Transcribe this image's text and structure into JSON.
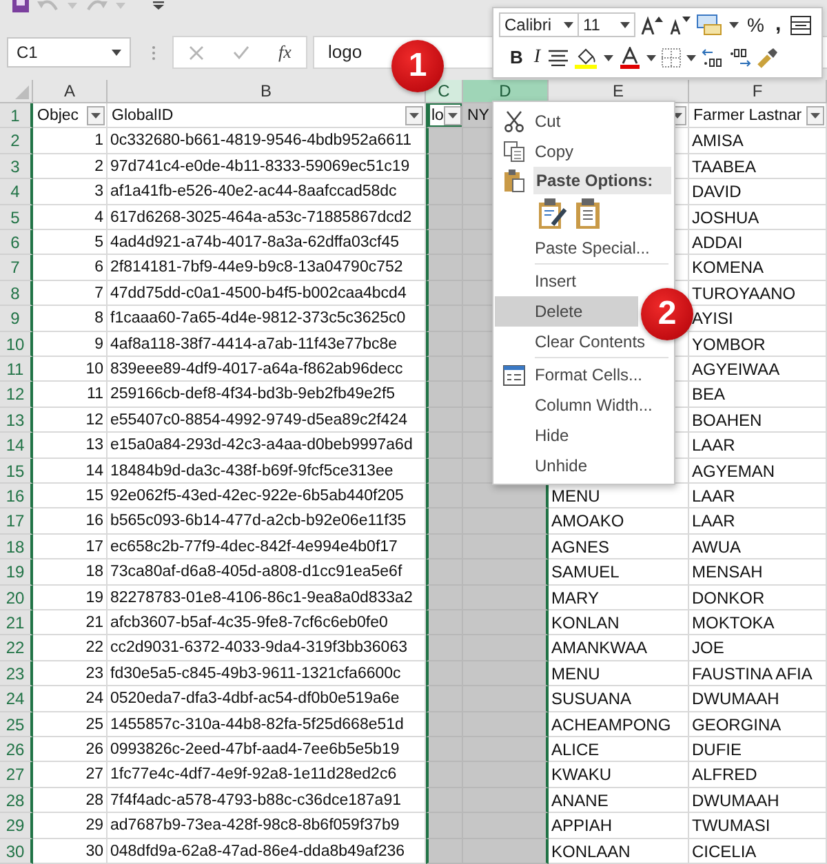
{
  "formula_bar": {
    "name_box": "C1",
    "function_label": "fx",
    "formula": "logo"
  },
  "mini_toolbar": {
    "font": "Calibri",
    "size": "11",
    "percent": "%",
    "comma": ",",
    "bold": "B",
    "italic": "I"
  },
  "sheet": {
    "columns": [
      {
        "letter": "A",
        "selected": false,
        "hot": false
      },
      {
        "letter": "B",
        "selected": false,
        "hot": false
      },
      {
        "letter": "C",
        "selected": true,
        "hot": false
      },
      {
        "letter": "D",
        "selected": true,
        "hot": true
      },
      {
        "letter": "E",
        "selected": false,
        "hot": false
      },
      {
        "letter": "F",
        "selected": false,
        "hot": false
      }
    ],
    "header_row": {
      "number": "1",
      "cells": [
        {
          "text": "Objec",
          "filter": true,
          "active": false
        },
        {
          "text": "GlobalID",
          "filter": true,
          "active": false
        },
        {
          "text": "lo",
          "filter": true,
          "active": true
        },
        {
          "text": "NY",
          "filter": false,
          "active": false
        },
        {
          "filter": true,
          "active": false
        },
        {
          "text": "Farmer Lastnar",
          "filter": true,
          "active": false
        }
      ]
    },
    "rows": [
      {
        "number": "2",
        "cells": [
          "1",
          "0c332680-b661-4819-9546-4bdb952a6611",
          null,
          null,
          null,
          "AMISA"
        ]
      },
      {
        "number": "3",
        "cells": [
          "2",
          "97d741c4-e0de-4b11-8333-59069ec51c19",
          null,
          null,
          null,
          "TAABEA"
        ]
      },
      {
        "number": "4",
        "cells": [
          "3",
          "af1a41fb-e526-40e2-ac44-8aafccad58dc",
          null,
          null,
          null,
          "DAVID"
        ]
      },
      {
        "number": "5",
        "cells": [
          "4",
          "617d6268-3025-464a-a53c-71885867dcd2",
          null,
          null,
          null,
          "JOSHUA"
        ]
      },
      {
        "number": "6",
        "cells": [
          "5",
          "4ad4d921-a74b-4017-8a3a-62dffa03cf45",
          null,
          null,
          null,
          "ADDAI"
        ]
      },
      {
        "number": "7",
        "cells": [
          "6",
          "2f814181-7bf9-44e9-b9c8-13a04790c752",
          null,
          null,
          null,
          "KOMENA"
        ]
      },
      {
        "number": "8",
        "cells": [
          "7",
          "47dd75dd-c0a1-4500-b4f5-b002caa4bcd4",
          null,
          null,
          null,
          "TUROYAANO"
        ]
      },
      {
        "number": "9",
        "cells": [
          "8",
          "f1caaa60-7a65-4d4e-9812-373c5c3625c0",
          null,
          null,
          null,
          "AYISI"
        ]
      },
      {
        "number": "10",
        "cells": [
          "9",
          "4af8a118-38f7-4414-a7ab-11f43e77bc8e",
          null,
          null,
          null,
          "YOMBOR"
        ]
      },
      {
        "number": "11",
        "cells": [
          "10",
          "839eee89-4df9-4017-a64a-f862ab96decc",
          null,
          null,
          null,
          "AGYEIWAA"
        ]
      },
      {
        "number": "12",
        "cells": [
          "11",
          "259166cb-def8-4f34-bd3b-9eb2fb49e2f5",
          null,
          null,
          null,
          "BEA"
        ]
      },
      {
        "number": "13",
        "cells": [
          "12",
          "e55407c0-8854-4992-9749-d5ea89c2f424",
          null,
          null,
          null,
          "BOAHEN"
        ]
      },
      {
        "number": "14",
        "cells": [
          "13",
          "e15a0a84-293d-42c3-a4aa-d0beb9997a6d",
          null,
          null,
          null,
          "LAAR"
        ]
      },
      {
        "number": "15",
        "cells": [
          "14",
          "18484b9d-da3c-438f-b69f-9fcf5ce313ee",
          null,
          null,
          null,
          "AGYEMAN"
        ]
      },
      {
        "number": "16",
        "cells": [
          "15",
          "92e062f5-43ed-42ec-922e-6b5ab440f205",
          null,
          null,
          "MENU",
          "LAAR"
        ]
      },
      {
        "number": "17",
        "cells": [
          "16",
          "b565c093-6b14-477d-a2cb-b92e06e11f35",
          null,
          null,
          "AMOAKO",
          "LAAR"
        ]
      },
      {
        "number": "18",
        "cells": [
          "17",
          "ec658c2b-77f9-4dec-842f-4e994e4b0f17",
          null,
          null,
          "AGNES",
          "AWUA"
        ]
      },
      {
        "number": "19",
        "cells": [
          "18",
          "73ca80af-d6a8-405d-a808-d1cc91ea5e6f",
          null,
          null,
          "SAMUEL",
          "MENSAH"
        ]
      },
      {
        "number": "20",
        "cells": [
          "19",
          "82278783-01e8-4106-86c1-9ea8a0d833a2",
          null,
          null,
          "MARY",
          "DONKOR"
        ]
      },
      {
        "number": "21",
        "cells": [
          "21",
          "afcb3607-b5af-4c35-9fe8-7cf6c6eb0fe0",
          null,
          null,
          "KONLAN",
          "MOKTOKA"
        ]
      },
      {
        "number": "22",
        "cells": [
          "22",
          "cc2d9031-6372-4033-9da4-319f3bb36063",
          null,
          null,
          "AMANKWAA",
          "JOE"
        ]
      },
      {
        "number": "23",
        "cells": [
          "23",
          "fd30e5a5-c845-49b3-9611-1321cfa6600c",
          null,
          null,
          "MENU",
          "FAUSTINA AFIA"
        ]
      },
      {
        "number": "24",
        "cells": [
          "24",
          "0520eda7-dfa3-4dbf-ac54-df0b0e519a6e",
          null,
          null,
          "SUSUANA",
          "DWUMAAH"
        ]
      },
      {
        "number": "25",
        "cells": [
          "25",
          "1455857c-310a-44b8-82fa-5f25d668e51d",
          null,
          null,
          "ACHEAMPONG",
          "GEORGINA"
        ]
      },
      {
        "number": "26",
        "cells": [
          "26",
          "0993826c-2eed-47bf-aad4-7ee6b5e5b19",
          null,
          null,
          "ALICE",
          "DUFIE"
        ]
      },
      {
        "number": "27",
        "cells": [
          "27",
          "1fc77e4c-4df7-4e9f-92a8-1e11d28ed2c6",
          null,
          null,
          "KWAKU",
          "ALFRED"
        ]
      },
      {
        "number": "28",
        "cells": [
          "28",
          "7f4f4adc-a578-4793-b88c-c36dce187a91",
          null,
          null,
          "ANANE",
          "DWUMAAH"
        ]
      },
      {
        "number": "29",
        "cells": [
          "29",
          "ad7687b9-73ea-428f-98c8-8b6f059f37b9",
          null,
          null,
          "APPIAH",
          "TWUMASI"
        ]
      },
      {
        "number": "30",
        "cells": [
          "30",
          "048dfd9a-62a8-47ad-86e4-dda8b49af236",
          null,
          null,
          "KONLAAN",
          "CICELIA"
        ]
      }
    ]
  },
  "context_menu": {
    "items": [
      {
        "kind": "command",
        "label": "Cut",
        "selected": false
      },
      {
        "kind": "command",
        "label": "Copy",
        "selected": false
      },
      {
        "kind": "header",
        "label": "Paste Options:"
      },
      {
        "kind": "paste-icons"
      },
      {
        "kind": "command",
        "label": "Paste Special...",
        "selected": false
      },
      {
        "kind": "separator"
      },
      {
        "kind": "command",
        "label": "Insert",
        "selected": false
      },
      {
        "kind": "command",
        "label": "Delete",
        "selected": true
      },
      {
        "kind": "command",
        "label": "Clear Contents",
        "selected": false
      },
      {
        "kind": "separator"
      },
      {
        "kind": "command",
        "label": "Format Cells...",
        "selected": false
      },
      {
        "kind": "command",
        "label": "Column Width...",
        "selected": false
      },
      {
        "kind": "command",
        "label": "Hide",
        "selected": false
      },
      {
        "kind": "command",
        "label": "Unhide",
        "selected": false
      }
    ]
  },
  "callouts": [
    {
      "number": "1"
    },
    {
      "number": "2"
    }
  ]
}
